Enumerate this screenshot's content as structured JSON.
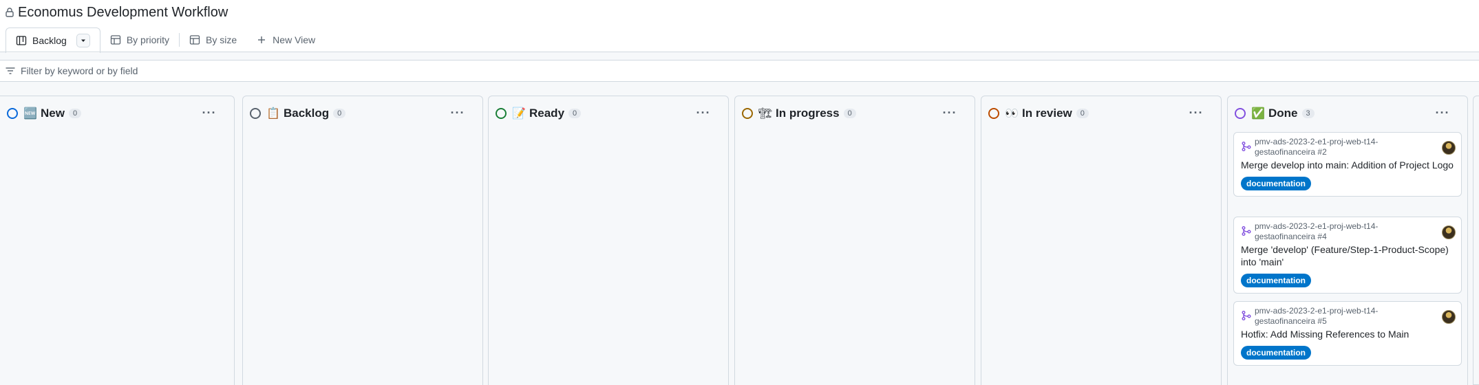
{
  "project": {
    "title": "Economus Development Workflow"
  },
  "tabs": [
    {
      "label": "Backlog",
      "icon": "board-icon"
    },
    {
      "label": "By priority",
      "icon": "table-icon"
    },
    {
      "label": "By size",
      "icon": "table-icon"
    },
    {
      "label": "New View",
      "icon": "plus-icon"
    }
  ],
  "filter": {
    "placeholder": "Filter by keyword or by field"
  },
  "columns": [
    {
      "name": "New",
      "emoji": "🆕",
      "count": "0",
      "color": "#0969da"
    },
    {
      "name": "Backlog",
      "emoji": "📋",
      "count": "0",
      "color": "#59636e"
    },
    {
      "name": "Ready",
      "emoji": "📝",
      "count": "0",
      "color": "#1a7f37"
    },
    {
      "name": "In progress",
      "emoji": "🏗",
      "count": "0",
      "color": "#9a6700"
    },
    {
      "name": "In review",
      "emoji": "👀",
      "count": "0",
      "color": "#bc4c00"
    },
    {
      "name": "Done",
      "emoji": "✅",
      "count": "3",
      "color": "#8250df"
    }
  ],
  "done_cards": [
    {
      "repo": "pmv-ads-2023-2-e1-proj-web-t14-gestaofinanceira #2",
      "title": "Merge develop into main: Addition of Project Logo",
      "label": "documentation"
    },
    {
      "repo": "pmv-ads-2023-2-e1-proj-web-t14-gestaofinanceira #4",
      "title": "Merge 'develop' (Feature/Step-1-Product-Scope) into 'main'",
      "label": "documentation"
    },
    {
      "repo": "pmv-ads-2023-2-e1-proj-web-t14-gestaofinanceira #5",
      "title": "Hotfix: Add Missing References to Main",
      "label": "documentation"
    }
  ],
  "colors": {
    "label_bg": "#0075ca",
    "pr_icon": "#8250df"
  }
}
